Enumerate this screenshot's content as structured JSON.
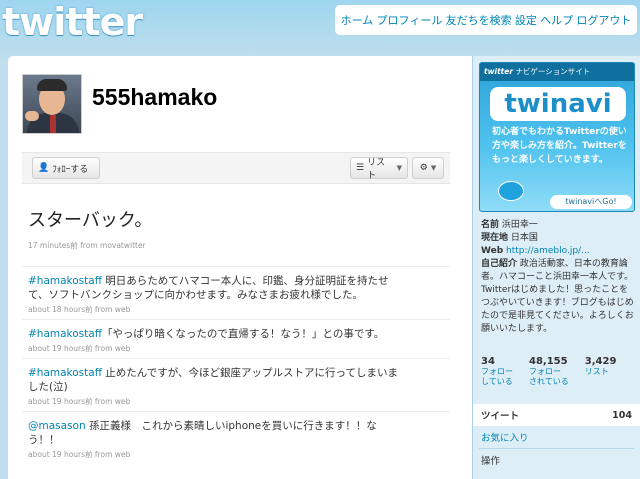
{
  "logo": "twitter",
  "nav": {
    "items": [
      "ホーム",
      "プロフィール",
      "友だちを検索",
      "設定",
      "ヘルプ",
      "ログアウト"
    ]
  },
  "profile_header": {
    "username": "555hamako"
  },
  "actions": {
    "follow_label": "ﾌｫﾛｰする",
    "list_label": "リスト",
    "gear_icon": "gear-icon"
  },
  "status": {
    "text": "スターバック。",
    "meta": "17 minutes前 from movatwitter"
  },
  "tweets": [
    {
      "user": "#hamakostaff",
      "text": " 明日あらためてハマコー本人に、印鑑、身分証明証を持たせて、ソフトバンクショップに向かわせます。みなさまお疲れ様でした。",
      "meta": "about 18 hours前 from web"
    },
    {
      "user": "#hamakostaff",
      "text": "「やっぱり暗くなったので直帰する！なう！」との事です。",
      "meta": "about 19 hours前 from web"
    },
    {
      "user": "#hamakostaff",
      "text": " 止めたんですが、今ほど銀座アップルストアに行ってしまいました(泣)",
      "meta": "about 19 hours前 from web"
    },
    {
      "user": "@masason",
      "text": " 孫正義様　これから素晴しいiphoneを買いに行きます！！なう！！",
      "meta": "about 19 hours前 from web"
    }
  ],
  "sidebar": {
    "banner": {
      "header_brand": "twitter",
      "header_text": "ナビゲーションサイト",
      "brand": "twinavi",
      "text": "初心者でもわかるTwitterの使い方や楽しみ方を紹介。Twitterをもっと楽しくしていきます。",
      "go": "twinaviへGo!"
    },
    "profile": {
      "name_label": "名前",
      "name_value": "浜田幸一",
      "location_label": "現在地",
      "location_value": "日本国",
      "web_label": "Web",
      "web_value": "http://ameblo.jp/...",
      "bio_label": "自己紹介",
      "bio_value": "政治活動家、日本の教育論者。ハマコーこと浜田幸一本人です。Twitterはじめました！思ったことをつぶやいていきます！ブログもはじめたので是非見てください。よろしくお願いいたします。"
    },
    "stats": [
      {
        "num": "34",
        "label1": "フォロー",
        "label2": "している"
      },
      {
        "num": "48,155",
        "label1": "フォロー",
        "label2": "されている"
      },
      {
        "num": "3,429",
        "label1": "リスト",
        "label2": ""
      }
    ],
    "tweets_label": "ツイート",
    "tweets_count": "104",
    "favorites_label": "お気に入り",
    "actions_label": "操作"
  }
}
